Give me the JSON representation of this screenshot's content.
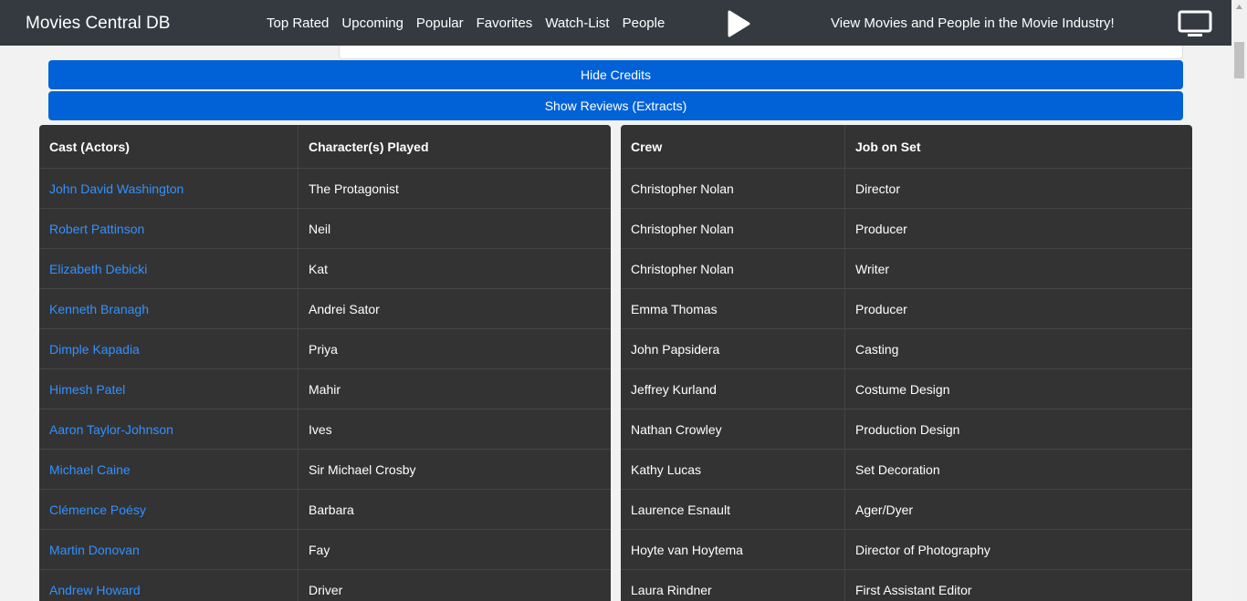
{
  "navbar": {
    "brand": "Movies Central DB",
    "links": [
      "Top Rated",
      "Upcoming",
      "Popular",
      "Favorites",
      "Watch-List",
      "People"
    ],
    "tagline": "View Movies and People in the Movie Industry!",
    "play_icon": "play-icon",
    "monitor_icon": "monitor-icon"
  },
  "buttons": {
    "hide_credits": "Hide Credits",
    "show_reviews": "Show Reviews (Extracts)"
  },
  "cast_table": {
    "headers": [
      "Cast (Actors)",
      "Character(s) Played"
    ],
    "rows": [
      [
        "John David Washington",
        "The Protagonist"
      ],
      [
        "Robert Pattinson",
        "Neil"
      ],
      [
        "Elizabeth Debicki",
        "Kat"
      ],
      [
        "Kenneth Branagh",
        "Andrei Sator"
      ],
      [
        "Dimple Kapadia",
        "Priya"
      ],
      [
        "Himesh Patel",
        "Mahir"
      ],
      [
        "Aaron Taylor-Johnson",
        "Ives"
      ],
      [
        "Michael Caine",
        "Sir Michael Crosby"
      ],
      [
        "Clémence Poésy",
        "Barbara"
      ],
      [
        "Martin Donovan",
        "Fay"
      ],
      [
        "Andrew Howard",
        "Driver"
      ]
    ]
  },
  "crew_table": {
    "headers": [
      "Crew",
      "Job on Set"
    ],
    "rows": [
      [
        "Christopher Nolan",
        "Director"
      ],
      [
        "Christopher Nolan",
        "Producer"
      ],
      [
        "Christopher Nolan",
        "Writer"
      ],
      [
        "Emma Thomas",
        "Producer"
      ],
      [
        "John Papsidera",
        "Casting"
      ],
      [
        "Jeffrey Kurland",
        "Costume Design"
      ],
      [
        "Nathan Crowley",
        "Production Design"
      ],
      [
        "Kathy Lucas",
        "Set Decoration"
      ],
      [
        "Laurence Esnault",
        "Ager/Dyer"
      ],
      [
        "Hoyte van Hoytema",
        "Director of Photography"
      ],
      [
        "Laura Rindner",
        "First Assistant Editor"
      ]
    ]
  },
  "colors": {
    "navbar": "#343a40",
    "button": "#0062d6",
    "table": "#333333",
    "link": "#3391ff"
  }
}
